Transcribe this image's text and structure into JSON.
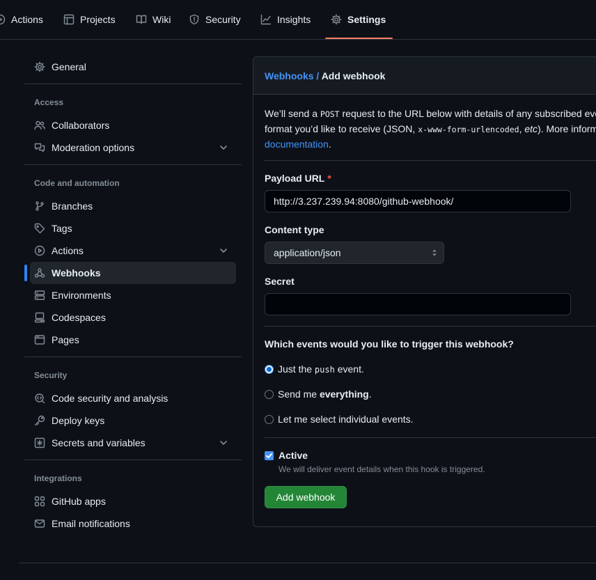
{
  "topnav": {
    "tabs": [
      {
        "label": "Actions",
        "icon": "play-icon"
      },
      {
        "label": "Projects",
        "icon": "table-icon"
      },
      {
        "label": "Wiki",
        "icon": "book-icon"
      },
      {
        "label": "Security",
        "icon": "shield-icon"
      },
      {
        "label": "Insights",
        "icon": "graph-icon"
      },
      {
        "label": "Settings",
        "icon": "gear-icon",
        "active": true
      }
    ],
    "active_underline_color": "#f78166"
  },
  "sidebar": {
    "general": "General",
    "access": {
      "heading": "Access",
      "items": [
        {
          "label": "Collaborators",
          "icon": "people-icon"
        },
        {
          "label": "Moderation options",
          "icon": "comment-discussion-icon",
          "expandable": true
        }
      ]
    },
    "code": {
      "heading": "Code and automation",
      "items": [
        {
          "label": "Branches",
          "icon": "git-branch-icon"
        },
        {
          "label": "Tags",
          "icon": "tag-icon"
        },
        {
          "label": "Actions",
          "icon": "play-icon",
          "expandable": true
        },
        {
          "label": "Webhooks",
          "icon": "webhook-icon",
          "active": true
        },
        {
          "label": "Environments",
          "icon": "server-icon"
        },
        {
          "label": "Codespaces",
          "icon": "codespaces-icon"
        },
        {
          "label": "Pages",
          "icon": "browser-icon"
        }
      ]
    },
    "security": {
      "heading": "Security",
      "items": [
        {
          "label": "Code security and analysis",
          "icon": "codescan-icon"
        },
        {
          "label": "Deploy keys",
          "icon": "key-icon"
        },
        {
          "label": "Secrets and variables",
          "icon": "asterisk-icon",
          "expandable": true
        }
      ]
    },
    "integrations": {
      "heading": "Integrations",
      "items": [
        {
          "label": "GitHub apps",
          "icon": "apps-icon"
        },
        {
          "label": "Email notifications",
          "icon": "mail-icon"
        }
      ]
    }
  },
  "main": {
    "breadcrumb": {
      "parent": "Webhooks",
      "separator": " / ",
      "current": "Add webhook"
    },
    "intro": {
      "p1": "We’ll send a ",
      "code1": "POST",
      "p2": " request to the URL below with details of any subscribed eve",
      "p3": "format you’d like to receive (JSON, ",
      "code2": "x-www-form-urlencoded",
      "p4": ", ",
      "em": "etc",
      "p5": "). More inform",
      "link": "documentation",
      "p6": "."
    },
    "payload_url": {
      "label": "Payload URL",
      "required_mark": "*",
      "value": "http://3.237.239.94:8080/github-webhook/"
    },
    "content_type": {
      "label": "Content type",
      "value": "application/json"
    },
    "secret": {
      "label": "Secret",
      "value": ""
    },
    "events": {
      "question": "Which events would you like to trigger this webhook?",
      "opt1": {
        "pre": "Just the ",
        "code": "push",
        "post": " event.",
        "selected": true
      },
      "opt2": {
        "pre": "Send me ",
        "bold": "everything",
        "post": ".",
        "selected": false
      },
      "opt3": {
        "label": "Let me select individual events.",
        "selected": false
      }
    },
    "active": {
      "label": "Active",
      "checked": true,
      "note": "We will deliver event details when this hook is triggered."
    },
    "submit": "Add webhook"
  },
  "colors": {
    "background": "#0d1117",
    "link": "#4493f8",
    "primary_button": "#238636",
    "active_indicator": "#2f81f7",
    "required": "#f85149"
  }
}
